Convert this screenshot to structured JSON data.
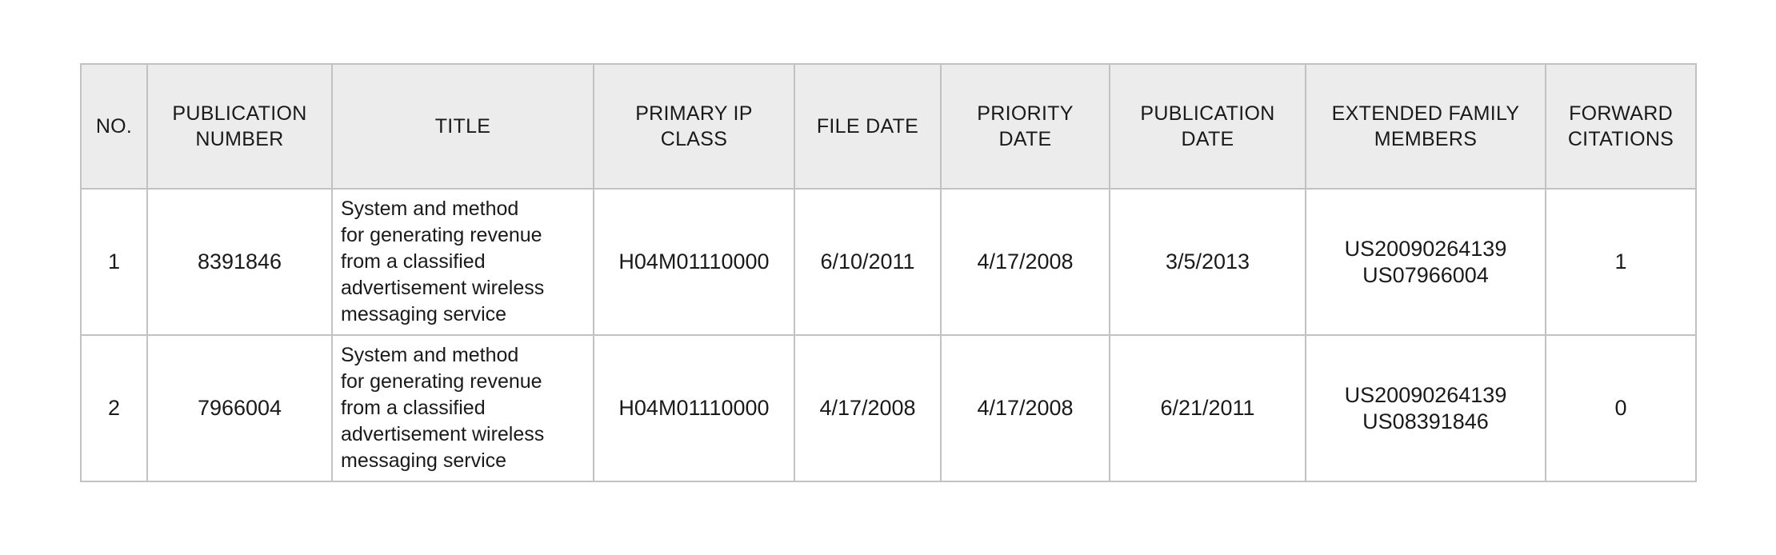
{
  "table": {
    "headers": [
      {
        "lines": [
          "NO."
        ]
      },
      {
        "lines": [
          "PUBLICATION",
          "NUMBER"
        ]
      },
      {
        "lines": [
          "TITLE"
        ]
      },
      {
        "lines": [
          "PRIMARY IP",
          "CLASS"
        ]
      },
      {
        "lines": [
          "FILE DATE"
        ]
      },
      {
        "lines": [
          "PRIORITY",
          "DATE"
        ]
      },
      {
        "lines": [
          "PUBLICATION",
          "DATE"
        ]
      },
      {
        "lines": [
          "EXTENDED FAMILY",
          "MEMBERS"
        ]
      },
      {
        "lines": [
          "FORWARD",
          "CITATIONS"
        ]
      }
    ],
    "rows": [
      {
        "no": "1",
        "publication_number": "8391846",
        "title_lines": [
          "System and method",
          "for generating revenue",
          "from a classified",
          "advertisement wireless",
          "messaging service"
        ],
        "primary_ip_class": "H04M01110000",
        "file_date": "6/10/2011",
        "priority_date": "4/17/2008",
        "publication_date": "3/5/2013",
        "extended_family_members": [
          "US20090264139",
          "US07966004"
        ],
        "forward_citations": "1"
      },
      {
        "no": "2",
        "publication_number": "7966004",
        "title_lines": [
          "System and method",
          "for generating revenue",
          "from a classified",
          "advertisement wireless",
          "messaging service"
        ],
        "primary_ip_class": "H04M01110000",
        "file_date": "4/17/2008",
        "priority_date": "4/17/2008",
        "publication_date": "6/21/2011",
        "extended_family_members": [
          "US20090264139",
          "US08391846"
        ],
        "forward_citations": "0"
      }
    ]
  },
  "colors": {
    "header_background": "#ececec",
    "border": "#c2c2c2",
    "text": "#1a1a1a"
  }
}
